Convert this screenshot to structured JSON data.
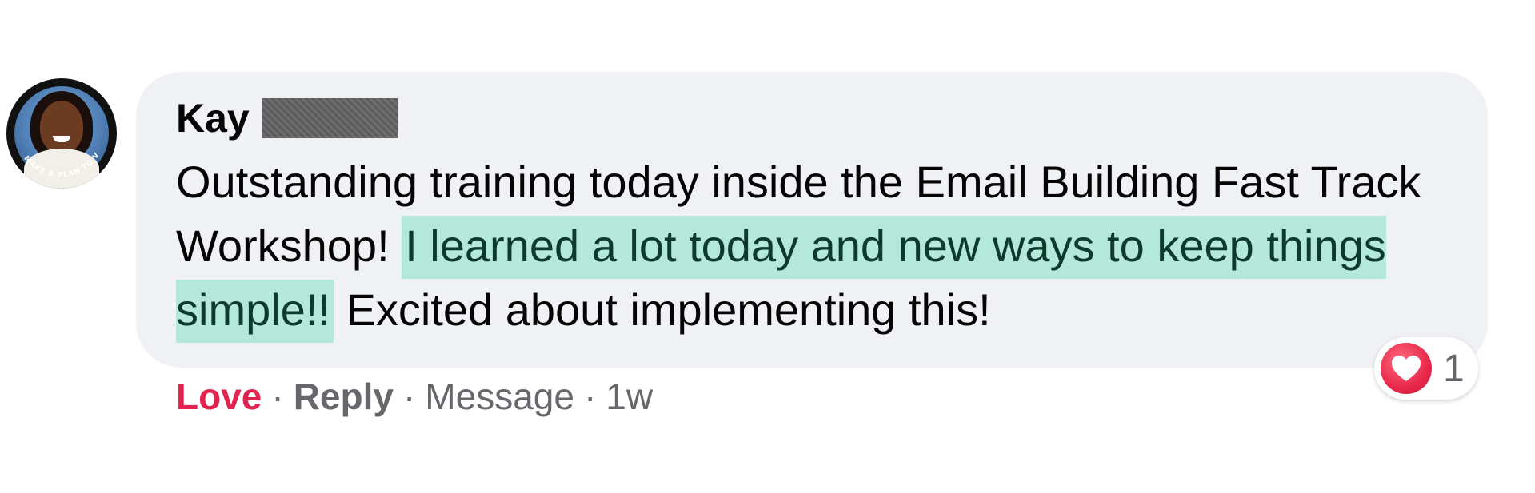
{
  "comment": {
    "author_first_name": "Kay",
    "text_before": "Outstanding training today inside the Email Building Fast Track Workshop! ",
    "text_highlighted": "I learned a lot today and new ways to keep things simple!!",
    "text_after": " Excited about implementing this!",
    "avatar_badge_text": "MAKE A PLAN TO VOTE"
  },
  "actions": {
    "love_label": "Love",
    "separator": "·",
    "reply_label": "Reply",
    "message_label": "Message",
    "timestamp": "1w"
  },
  "reactions": {
    "icon": "heart-icon",
    "count": "1"
  },
  "colors": {
    "bubble_bg": "#f0f1f4",
    "highlight_bg": "#b4e8d8",
    "love_red": "#e0244f",
    "meta_gray": "#65676b"
  }
}
